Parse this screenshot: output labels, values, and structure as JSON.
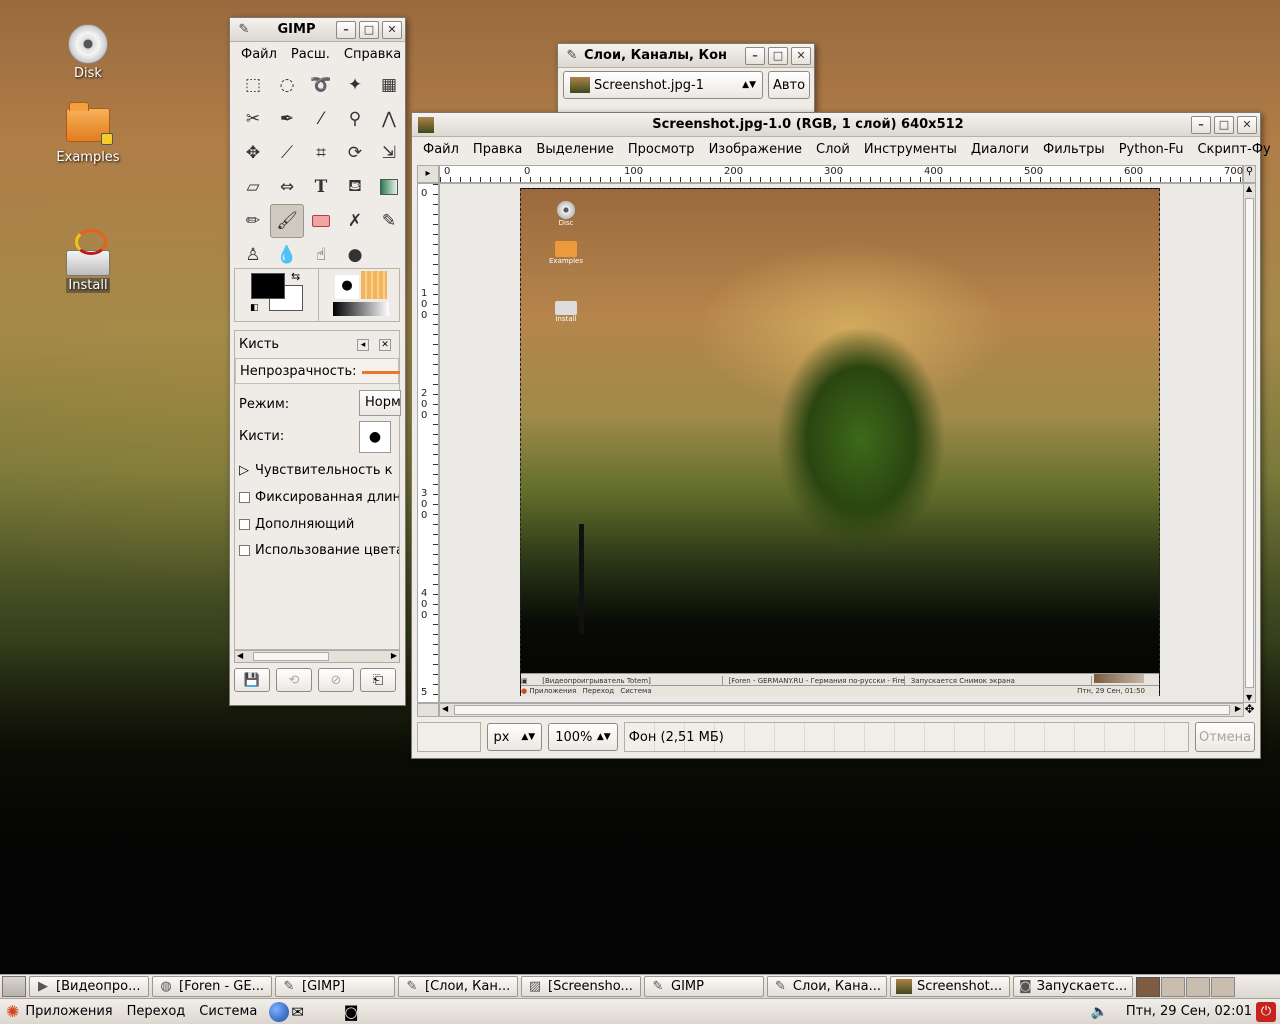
{
  "desktop": {
    "icons": [
      {
        "label": "Disk",
        "icon": "disc-icon"
      },
      {
        "label": "Examples",
        "icon": "folder-icon"
      },
      {
        "label": "Install",
        "icon": "installer-icon"
      }
    ]
  },
  "toolbox": {
    "title": "GIMP",
    "menu": [
      "Файл",
      "Расш.",
      "Справка"
    ],
    "tool_icons": [
      "rect-select-icon",
      "ellipse-select-icon",
      "lasso-icon",
      "fuzzy-select-icon",
      "color-select-icon",
      "scissors-icon",
      "paths-icon",
      "color-picker-icon",
      "zoom-icon",
      "measure-icon",
      "move-icon",
      "align-icon",
      "crop-icon",
      "rotate-icon",
      "scale-icon",
      "shear-icon",
      "flip-icon",
      "text-icon",
      "bucket-fill-icon",
      "blend-icon",
      "pencil-icon",
      "paintbrush-icon",
      "eraser-icon",
      "airbrush-icon",
      "ink-icon",
      "clone-icon",
      "blur-icon",
      "smudge-icon",
      "dodge-burn-icon"
    ],
    "brush_panel": {
      "title": "Кисть",
      "opacity_label": "Непрозрачность:",
      "mode_label": "Режим:",
      "mode_value": "Норм",
      "brushes_label": "Кисти:",
      "sensitivity_label": "Чувствительность к",
      "fixed_length_label": "Фиксированная длина",
      "incremental_label": "Дополняющий",
      "use_color_label": "Использование цвета"
    }
  },
  "layers_window": {
    "title": "Слои, Каналы, Кон",
    "image_select": "Screenshot.jpg-1",
    "auto_button": "Авто"
  },
  "image_window": {
    "title": "Screenshot.jpg-1.0 (RGB, 1 слой) 640x512",
    "menu": [
      "Файл",
      "Правка",
      "Выделение",
      "Просмотр",
      "Изображение",
      "Слой",
      "Инструменты",
      "Диалоги",
      "Фильтры",
      "Python-Fu",
      "Скрипт-Фу"
    ],
    "ruler_h": [
      "0",
      "0",
      "100",
      "200",
      "300",
      "400",
      "500",
      "600",
      "700"
    ],
    "ruler_v": [
      "0",
      "1 0 0",
      "2 0 0",
      "3 0 0",
      "4 0 0",
      "5"
    ],
    "mini_desktop": {
      "icons": [
        "Disc",
        "Examples",
        "Install"
      ],
      "tasks": [
        "[Видеопроигрыватель Totem]",
        "[Foren - GERMANY.RU - Германия по-русски - Fire",
        "Запускается Снимок экрана"
      ],
      "panel_menu": [
        "Приложения",
        "Переход",
        "Система"
      ],
      "clock": "Птн, 29 Сен, 01:50"
    },
    "unit": "px",
    "zoom": "100%",
    "status": "Фон (2,51 МБ)",
    "cancel_button": "Отмена"
  },
  "taskbar": {
    "tasks": [
      {
        "label": "[Видеопро...",
        "icon": "video-icon"
      },
      {
        "label": "[Foren - GE...",
        "icon": "globe-icon"
      },
      {
        "label": "[GIMP]",
        "icon": "gimp-icon"
      },
      {
        "label": "[Слои, Кан...",
        "icon": "gimp-icon"
      },
      {
        "label": "[Screensho...",
        "icon": "image-icon"
      },
      {
        "label": "GIMP",
        "icon": "gimp-icon"
      },
      {
        "label": "Слои, Кана...",
        "icon": "gimp-icon"
      },
      {
        "label": "Screenshot...",
        "icon": "image-icon"
      },
      {
        "label": "Запускаетс...",
        "icon": "camera-icon"
      }
    ]
  },
  "top_panel": {
    "menu": [
      "Приложения",
      "Переход",
      "Система"
    ],
    "clock": "Птн, 29 Сен, 02:01"
  }
}
